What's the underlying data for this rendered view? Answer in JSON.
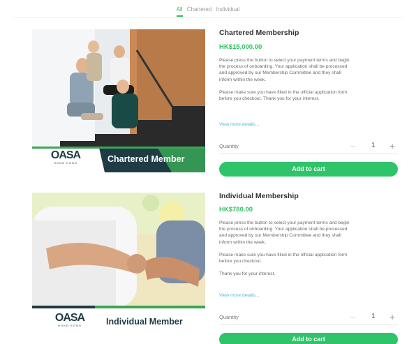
{
  "tabs": [
    {
      "label": "All",
      "active": true
    },
    {
      "label": "Chartered",
      "active": false
    },
    {
      "label": "Individual",
      "active": false
    }
  ],
  "products": [
    {
      "name": "Chartered Membership",
      "price": "HK$15,000.00",
      "desc_lines_1": [
        "Please press the button to select your payment terms and begin",
        "the process of onboarding. Your application shall be processed",
        "and approved by our Membership Committee and they shall",
        "inform within the week."
      ],
      "desc_lines_2": [
        "Please make sure you have filled in the official application form",
        "before you checkout. Thank you for your interest."
      ],
      "more_link": "View more details...",
      "quantity_label": "Quantity",
      "quantity": "1",
      "cart_label": "Add to cart",
      "banner_label": "Chartered Member",
      "logo_text": "OASA",
      "logo_sub": "HONG KONG"
    },
    {
      "name": "Individual Membership",
      "price": "HK$780.00",
      "desc_lines_1": [
        "Please press the button to select your payment terms and begin",
        "the process of onboarding. Your application shall be processed",
        "and approved by our Membership Committee and they shall",
        "inform within the week."
      ],
      "desc_lines_2": [
        "Please make sure you have filled in the official application form",
        "before you checkout."
      ],
      "desc_line_3": "Thank you for your interest.",
      "more_link": "View more details...",
      "quantity_label": "Quantity",
      "quantity": "1",
      "cart_label": "Add to cart",
      "banner_label": "Individual Member",
      "logo_text": "OASA",
      "logo_sub": "HONG KONG"
    }
  ],
  "colors": {
    "accent": "#2fbf5f",
    "cart_button": "#2ec46a",
    "link": "#4fb3d9",
    "banner_dark": "#1f3b44",
    "banner_green": "#3aa655"
  }
}
